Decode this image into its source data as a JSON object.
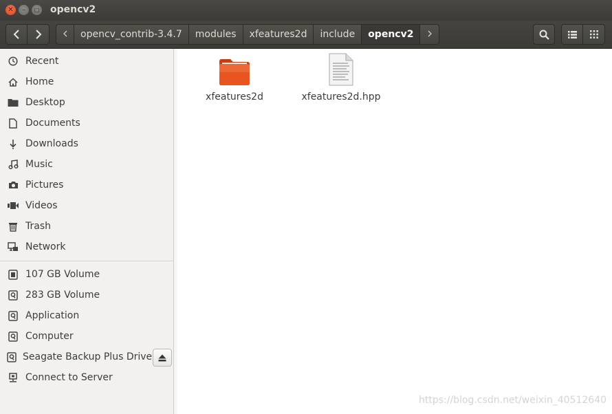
{
  "window": {
    "title": "opencv2"
  },
  "breadcrumbs": [
    "opencv_contrib-3.4.7",
    "modules",
    "xfeatures2d",
    "include",
    "opencv2"
  ],
  "sidebar": {
    "places": [
      {
        "label": "Recent",
        "icon": "clock-icon"
      },
      {
        "label": "Home",
        "icon": "home-icon"
      },
      {
        "label": "Desktop",
        "icon": "desktop-folder-icon"
      },
      {
        "label": "Documents",
        "icon": "document-icon"
      },
      {
        "label": "Downloads",
        "icon": "download-icon"
      },
      {
        "label": "Music",
        "icon": "music-icon"
      },
      {
        "label": "Pictures",
        "icon": "camera-icon"
      },
      {
        "label": "Videos",
        "icon": "video-icon"
      },
      {
        "label": "Trash",
        "icon": "trash-icon"
      },
      {
        "label": "Network",
        "icon": "network-icon"
      }
    ],
    "devices": [
      {
        "label": "107 GB Volume",
        "icon": "chip-drive-icon"
      },
      {
        "label": "283 GB Volume",
        "icon": "hard-drive-icon"
      },
      {
        "label": "Application",
        "icon": "hard-drive-icon"
      },
      {
        "label": "Computer",
        "icon": "hard-drive-icon"
      },
      {
        "label": "Seagate Backup Plus Drive",
        "icon": "hard-drive-icon"
      },
      {
        "label": "Connect to Server",
        "icon": "server-icon"
      }
    ]
  },
  "files": [
    {
      "name": "xfeatures2d",
      "type": "folder",
      "icon": "folder-icon"
    },
    {
      "name": "xfeatures2d.hpp",
      "type": "text",
      "icon": "text-file-icon"
    }
  ],
  "watermark": "https://blog.csdn.net/weixin_40512640",
  "colors": {
    "accent": "#dd4814",
    "folder": "#e95420",
    "titlebar": "#3c3b37"
  }
}
